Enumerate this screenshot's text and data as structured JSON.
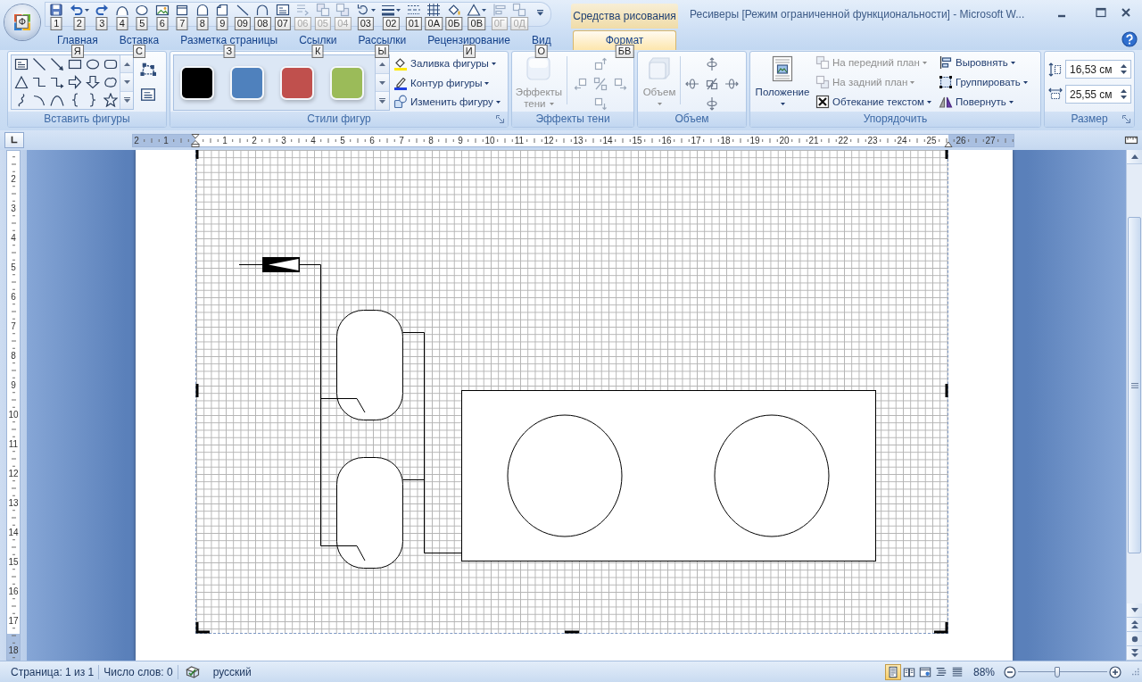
{
  "window": {
    "title": "Ресиверы [Режим ограниченной функциональности] - Microsoft W..."
  },
  "office_button": {
    "key_tip": "Ф"
  },
  "quick_access_toolbar": [
    {
      "kind": "save",
      "key_tip": "1",
      "disabled": false
    },
    {
      "kind": "undo",
      "key_tip": "2",
      "disabled": false
    },
    {
      "kind": "redo",
      "key_tip": "3",
      "disabled": false
    },
    {
      "kind": "freeform",
      "key_tip": "4",
      "disabled": false
    },
    {
      "kind": "oval",
      "key_tip": "5",
      "disabled": false
    },
    {
      "kind": "picture",
      "key_tip": "6",
      "disabled": false
    },
    {
      "kind": "rectangle",
      "key_tip": "7",
      "disabled": false
    },
    {
      "kind": "arch",
      "key_tip": "8",
      "disabled": false
    },
    {
      "kind": "folded",
      "key_tip": "9",
      "disabled": false
    },
    {
      "kind": "line",
      "key_tip": "09",
      "disabled": false
    },
    {
      "kind": "arc",
      "key_tip": "08",
      "disabled": false
    },
    {
      "kind": "text_box",
      "key_tip": "07",
      "disabled": false
    },
    {
      "kind": "text_direction",
      "key_tip": "06",
      "disabled": true
    },
    {
      "kind": "bring_forward",
      "key_tip": "05",
      "disabled": true
    },
    {
      "kind": "send_backward",
      "key_tip": "04",
      "disabled": true
    },
    {
      "kind": "rotate",
      "key_tip": "03",
      "disabled": false
    },
    {
      "kind": "line_weight",
      "key_tip": "02",
      "disabled": false
    },
    {
      "kind": "dash_style",
      "key_tip": "01",
      "disabled": false
    },
    {
      "kind": "grid",
      "key_tip": "0А",
      "disabled": false
    },
    {
      "kind": "fill",
      "key_tip": "0Б",
      "disabled": false
    },
    {
      "kind": "shape",
      "key_tip": "0В",
      "disabled": false
    },
    {
      "kind": "align",
      "key_tip": "0Г",
      "disabled": true
    },
    {
      "kind": "group",
      "key_tip": "0Д",
      "disabled": true
    }
  ],
  "tabs": [
    {
      "label": "Главная",
      "key_tip": "Я",
      "selected": false
    },
    {
      "label": "Вставка",
      "key_tip": "С",
      "selected": false
    },
    {
      "label": "Разметка страницы",
      "key_tip": "З",
      "selected": false
    },
    {
      "label": "Ссылки",
      "key_tip": "К",
      "selected": false
    },
    {
      "label": "Рассылки",
      "key_tip": "Ы",
      "selected": false
    },
    {
      "label": "Рецензирование",
      "key_tip": "И",
      "selected": false
    },
    {
      "label": "Вид",
      "key_tip": "О",
      "selected": false
    }
  ],
  "contextual_tab_group": {
    "title": "Средства рисования",
    "tabs": [
      {
        "label": "Формат",
        "key_tip": "БВ",
        "selected": true
      }
    ]
  },
  "ribbon": {
    "insert_shapes": {
      "label": "Вставить фигуры"
    },
    "shape_styles": {
      "label": "Стили фигур",
      "swatches": [
        {
          "color": "#000000"
        },
        {
          "color": "#4f81bd"
        },
        {
          "color": "#c0504d"
        },
        {
          "color": "#9bbb59"
        }
      ],
      "commands": [
        {
          "kind": "fill",
          "label": "Заливка фигуры"
        },
        {
          "kind": "outline",
          "label": "Контур фигуры"
        },
        {
          "kind": "change_shape",
          "label": "Изменить фигуру"
        }
      ]
    },
    "shadow_effects": {
      "label": "Эффекты тени",
      "button": {
        "label": "Эффекты тени",
        "disabled": true
      }
    },
    "effects_3d": {
      "label": "Объем",
      "button": {
        "label": "Объем",
        "disabled": true
      }
    },
    "arrange": {
      "label": "Упорядочить",
      "position": {
        "label": "Положение"
      },
      "commands": [
        {
          "kind": "bring_forward",
          "label": "На передний план",
          "disabled": true
        },
        {
          "kind": "send_backward",
          "label": "На задний план",
          "disabled": true
        },
        {
          "kind": "wrap_text",
          "label": "Обтекание текстом",
          "disabled": false
        },
        {
          "kind": "align",
          "label": "Выровнять",
          "disabled": false
        },
        {
          "kind": "group",
          "label": "Группировать",
          "disabled": false
        },
        {
          "kind": "rotate",
          "label": "Повернуть",
          "disabled": false
        }
      ]
    },
    "size": {
      "label": "Размер",
      "fields": [
        {
          "kind": "height",
          "value": "16,53 см"
        },
        {
          "kind": "width",
          "value": "25,55 см"
        }
      ]
    }
  },
  "horizontal_ruler": {
    "left_labels": [
      "2",
      "1"
    ],
    "labels": [
      "1",
      "2",
      "3",
      "4",
      "5",
      "6",
      "7",
      "8",
      "9",
      "10",
      "11",
      "12",
      "13",
      "14",
      "15",
      "16",
      "17",
      "18",
      "19",
      "20",
      "21",
      "22",
      "23",
      "24",
      "25",
      "26",
      "27"
    ]
  },
  "vertical_ruler": {
    "labels": [
      "2",
      "3",
      "4",
      "5",
      "6",
      "7",
      "8",
      "9",
      "10",
      "11",
      "12",
      "13",
      "14",
      "15",
      "16",
      "17",
      "18"
    ]
  },
  "document": {
    "canvas": {
      "selected": true
    }
  },
  "status_bar": {
    "page": "Страница: 1 из 1",
    "words": "Число слов: 0",
    "language": "русский",
    "views": [
      {
        "kind": "print_layout",
        "selected": true
      },
      {
        "kind": "full_screen_reading",
        "selected": false
      },
      {
        "kind": "web_layout",
        "selected": false
      },
      {
        "kind": "outline",
        "selected": false
      },
      {
        "kind": "draft",
        "selected": false
      }
    ],
    "zoom": "88%",
    "zoom_slider": {
      "level": 0.44
    }
  }
}
